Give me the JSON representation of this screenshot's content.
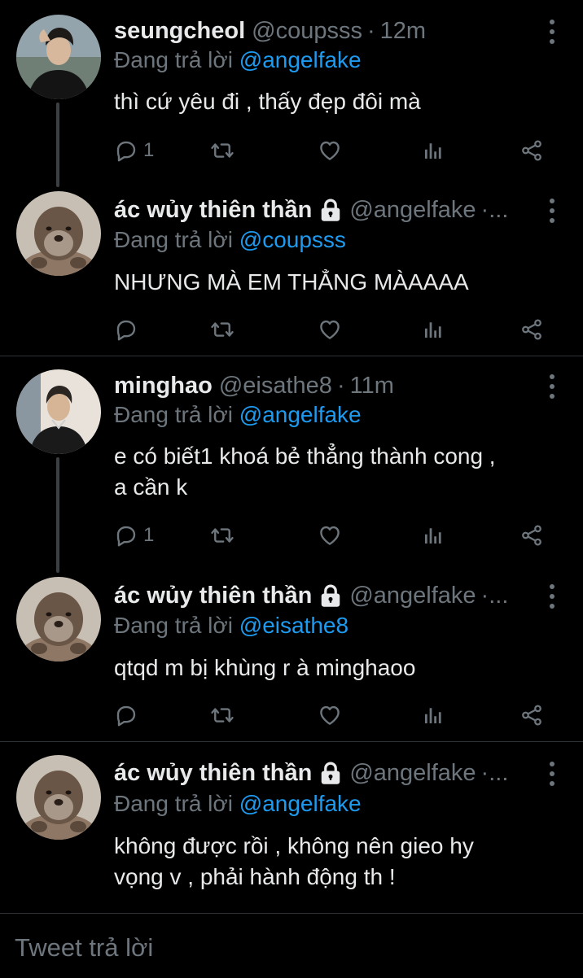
{
  "tweets": [
    {
      "display_name": "seungcheol",
      "handle": "@coupsss",
      "time": "12m",
      "replying_prefix": "Đang trả lời",
      "replying_to": "@angelfake",
      "body": "thì cứ yêu đi , thấy đẹp đôi mà",
      "reply_count": "1",
      "avatar_icon": "person-photo-avatar",
      "locked": false
    },
    {
      "display_name": "ác wủy thiên thần",
      "handle": "@angelfake",
      "time": "",
      "ellipsis": "·...",
      "replying_prefix": "Đang trả lời",
      "replying_to": "@coupsss",
      "body": "NHƯNG MÀ EM THẲNG MÀAAAA",
      "reply_count": "",
      "avatar_icon": "otter-photo-avatar",
      "locked": true
    },
    {
      "display_name": "minghao",
      "handle": "@eisathe8",
      "time": "11m",
      "replying_prefix": "Đang trả lời",
      "replying_to": "@angelfake",
      "body_lines": [
        "e có biết1 khoá bẻ thẳng thành cong ,",
        "a cần k"
      ],
      "reply_count": "1",
      "avatar_icon": "person-photo-avatar",
      "locked": false
    },
    {
      "display_name": "ác wủy thiên thần",
      "handle": "@angelfake",
      "time": "",
      "ellipsis": "·...",
      "replying_prefix": "Đang trả lời",
      "replying_to": "@eisathe8",
      "body": "qtqd m bị khùng r à minghaoo",
      "reply_count": "",
      "avatar_icon": "otter-photo-avatar",
      "locked": true
    },
    {
      "display_name": "ác wủy thiên thần",
      "handle": "@angelfake",
      "time": "",
      "ellipsis": "·...",
      "replying_prefix": "Đang trả lời",
      "replying_to": "@angelfake",
      "body_lines": [
        "không được rồi , không nên gieo hy",
        "vọng v , phải hành động th !"
      ],
      "avatar_icon": "otter-photo-avatar",
      "locked": true
    }
  ],
  "separator_dot": "·",
  "reply_bar": {
    "placeholder": "Tweet trả lời"
  },
  "colors": {
    "background": "#000000",
    "text": "#e7e9ea",
    "muted": "#6e767d",
    "accent": "#1d9bf0",
    "divider": "#2f3336"
  },
  "action_icons": [
    "reply-icon",
    "retweet-icon",
    "like-icon",
    "analytics-icon",
    "share-icon"
  ]
}
